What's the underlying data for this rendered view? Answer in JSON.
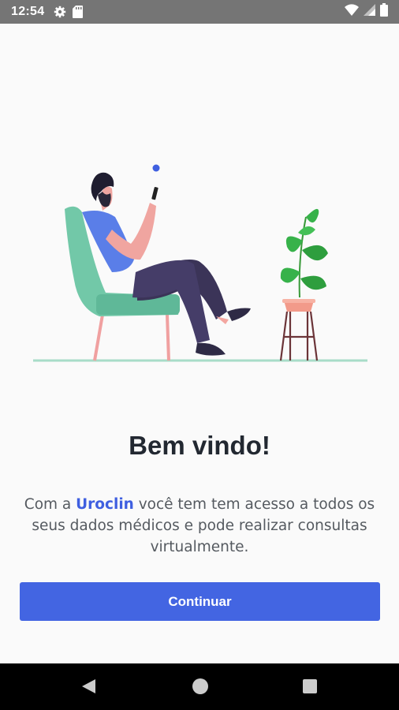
{
  "status_bar": {
    "time": "12:54",
    "icons_left": [
      "gear-icon",
      "sd-card-icon"
    ],
    "icons_right": [
      "wifi-icon",
      "cell-signal-icon",
      "battery-icon"
    ]
  },
  "welcome": {
    "title": "Bem vindo!",
    "description_prefix": "Com a ",
    "brand_name": "Uroclin",
    "description_suffix": " você tem tem acesso a todos os seus dados médicos e pode realizar consultas virtualmente."
  },
  "actions": {
    "continue_label": "Continuar"
  },
  "colors": {
    "primary": "#4365e2",
    "brand_text": "#3f5fe0",
    "status_bar": "#757575",
    "background": "#fafafa"
  },
  "navigation": {
    "buttons": [
      "back-icon",
      "home-icon",
      "recents-icon"
    ]
  }
}
